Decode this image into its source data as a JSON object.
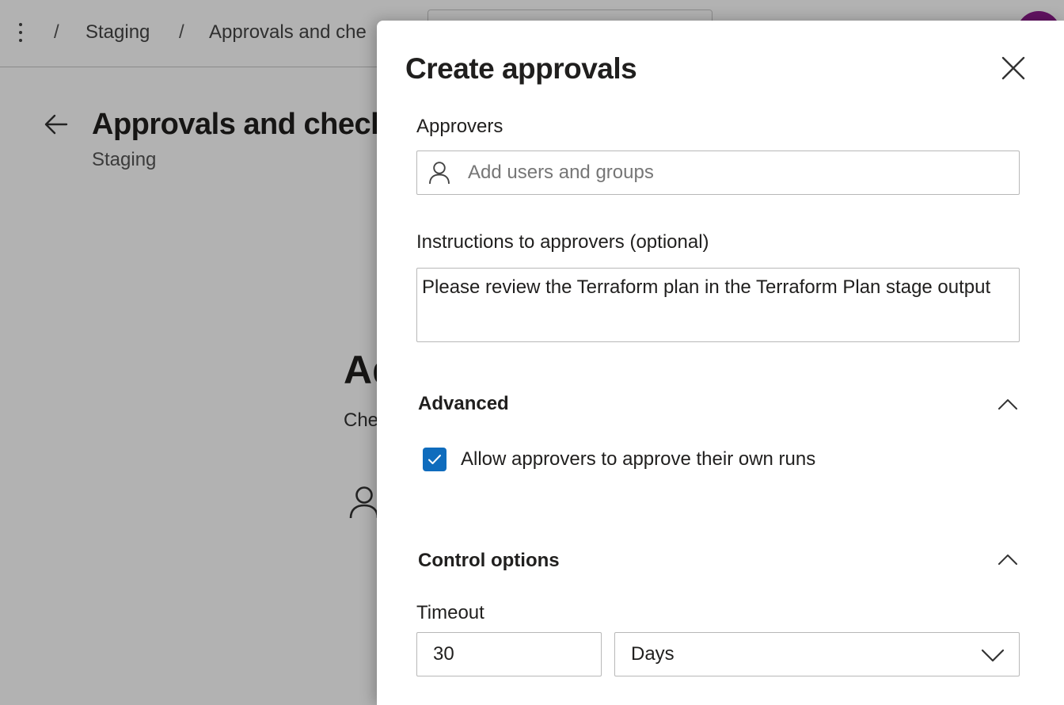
{
  "breadcrumb": {
    "items": [
      "Staging",
      "Approvals and che"
    ],
    "separator": "/"
  },
  "page": {
    "title": "Approvals and checks",
    "subtitle": "Staging",
    "background_heading": "Ad",
    "background_text": "Che"
  },
  "panel": {
    "title": "Create approvals",
    "approvers": {
      "label": "Approvers",
      "placeholder": "Add users and groups",
      "value": ""
    },
    "instructions": {
      "label": "Instructions to approvers (optional)",
      "value": "Please review the Terraform plan in the Terraform Plan stage output"
    },
    "advanced": {
      "title": "Advanced",
      "expanded": true,
      "allow_self_approve": {
        "label": "Allow approvers to approve their own runs",
        "checked": true
      }
    },
    "control_options": {
      "title": "Control options",
      "expanded": true,
      "timeout_label": "Timeout",
      "timeout_value": "30",
      "timeout_unit": "Days"
    }
  },
  "colors": {
    "accent": "#0f6cbd",
    "avatar": "#8b1a8b"
  },
  "icons": {
    "close": "close-icon",
    "person": "person-icon",
    "back": "arrow-left-icon",
    "collapse": "chevron-up-icon",
    "dropdown": "chevron-down-icon",
    "check": "checkmark-icon",
    "more": "more-vertical-icon"
  }
}
